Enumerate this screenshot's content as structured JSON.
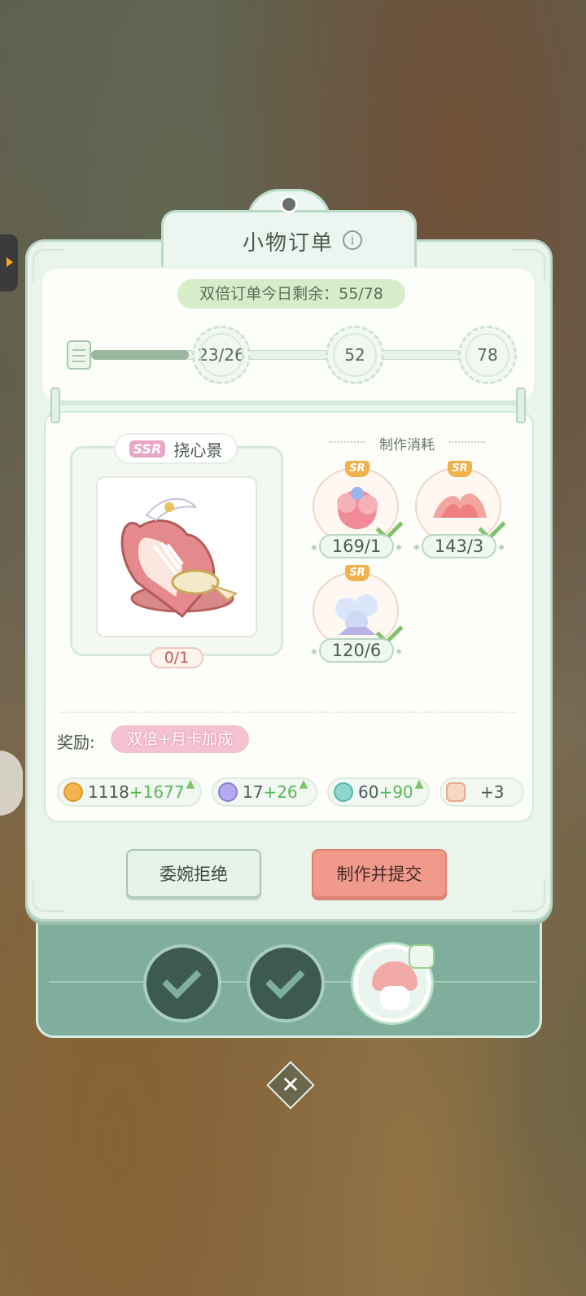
{
  "dialog": {
    "title": "小物订单",
    "info_icon": "i",
    "double_orders_text": "双倍订单今日剩余：55/78",
    "double_orders_used": 55,
    "double_orders_total": 78
  },
  "progress": {
    "milestones": [
      "23/26",
      "52",
      "78"
    ]
  },
  "item": {
    "rarity": "SSR",
    "name": "挠心景",
    "count": "0/1"
  },
  "materials": {
    "title": "制作消耗",
    "items": [
      {
        "rarity": "SR",
        "count": "169/1",
        "color": "#f08a96"
      },
      {
        "rarity": "SR",
        "count": "143/3",
        "color": "#f3a6a0"
      },
      {
        "rarity": "SR",
        "count": "120/6",
        "color": "#b7b3e8"
      }
    ]
  },
  "reward": {
    "label": "奖励:",
    "tag": "双倍+月卡加成",
    "items": [
      {
        "icon": "coin-icon",
        "base": "1118",
        "bonus": "+1677",
        "color": "#f2b54d"
      },
      {
        "icon": "blue-gem-icon",
        "base": "17",
        "bonus": "+26",
        "color": "#9a8ee0"
      },
      {
        "icon": "exp-icon",
        "base": "60",
        "bonus": "+90",
        "color": "#6cc3c0"
      },
      {
        "icon": "extra-reward-icon",
        "base": "+3",
        "bonus": "",
        "color": "#f2c0a8"
      }
    ]
  },
  "buttons": {
    "refuse": "委婉拒绝",
    "submit": "制作并提交"
  },
  "close_symbol": "✕"
}
